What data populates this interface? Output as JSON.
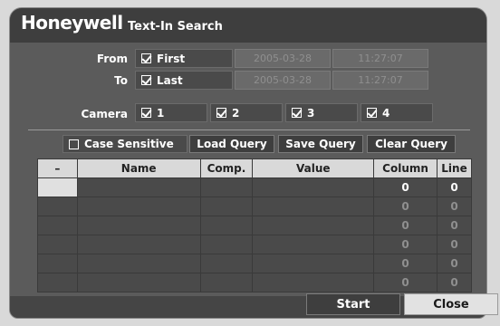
{
  "brand": "Honeywell",
  "title": "Text-In Search",
  "from": {
    "label": "From",
    "option": "First",
    "checked": true,
    "date": "2005-03-28",
    "time": "11:27:07"
  },
  "to": {
    "label": "To",
    "option": "Last",
    "checked": true,
    "date": "2005-03-28",
    "time": "11:27:07"
  },
  "camera": {
    "label": "Camera",
    "items": [
      {
        "label": "1",
        "checked": true
      },
      {
        "label": "2",
        "checked": true
      },
      {
        "label": "3",
        "checked": true
      },
      {
        "label": "4",
        "checked": true
      }
    ]
  },
  "toolbar": {
    "case_sensitive": "Case Sensitive",
    "case_checked": false,
    "load": "Load Query",
    "save": "Save Query",
    "clear": "Clear Query"
  },
  "table": {
    "headers": [
      "–",
      "Name",
      "Comp.",
      "Value",
      "Column",
      "Line"
    ],
    "rows": [
      [
        "",
        "",
        "",
        "",
        "0",
        "0"
      ],
      [
        "",
        "",
        "",
        "",
        "0",
        "0"
      ],
      [
        "",
        "",
        "",
        "",
        "0",
        "0"
      ],
      [
        "",
        "",
        "",
        "",
        "0",
        "0"
      ],
      [
        "",
        "",
        "",
        "",
        "0",
        "0"
      ],
      [
        "",
        "",
        "",
        "",
        "0",
        "0"
      ]
    ]
  },
  "footer": {
    "start": "Start",
    "close": "Close"
  }
}
